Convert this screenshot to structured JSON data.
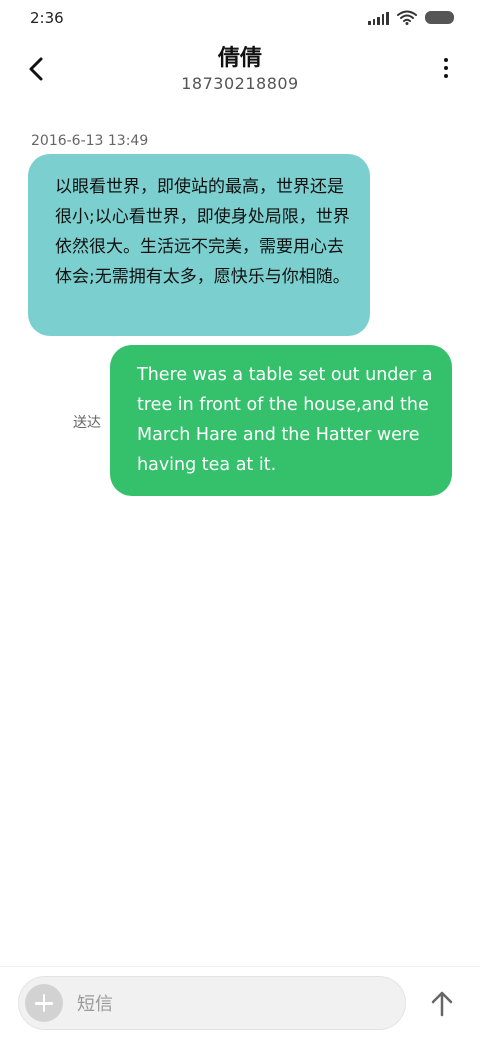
{
  "status_bar": {
    "time": "2:36",
    "icons": [
      "signal-icon",
      "wifi-icon",
      "battery-icon"
    ]
  },
  "header": {
    "contact_name": "倩倩",
    "contact_number": "18730218809",
    "icons": [
      "back-arrow-icon",
      "more-vert-icon"
    ]
  },
  "conversation": {
    "timestamp": "2016-6-13 13:49",
    "messages": [
      {
        "direction": "received",
        "text": "以眼看世界，即使站的最高，世界还是很小;以心看世界，即使身处局限，世界依然很大。生活远不完美，需要用心去体会;无需拥有太多，愿快乐与你相随。",
        "bubble_color": "#7ccfcf"
      },
      {
        "direction": "sent",
        "text": "There was a table set out under a tree in front of the house,and the March Hare and the Hatter were having tea at it.",
        "status": "送达",
        "bubble_color": "#35c06c"
      }
    ]
  },
  "composer": {
    "placeholder": "短信",
    "value": "",
    "icons": [
      "add-icon",
      "send-arrow-icon"
    ]
  }
}
